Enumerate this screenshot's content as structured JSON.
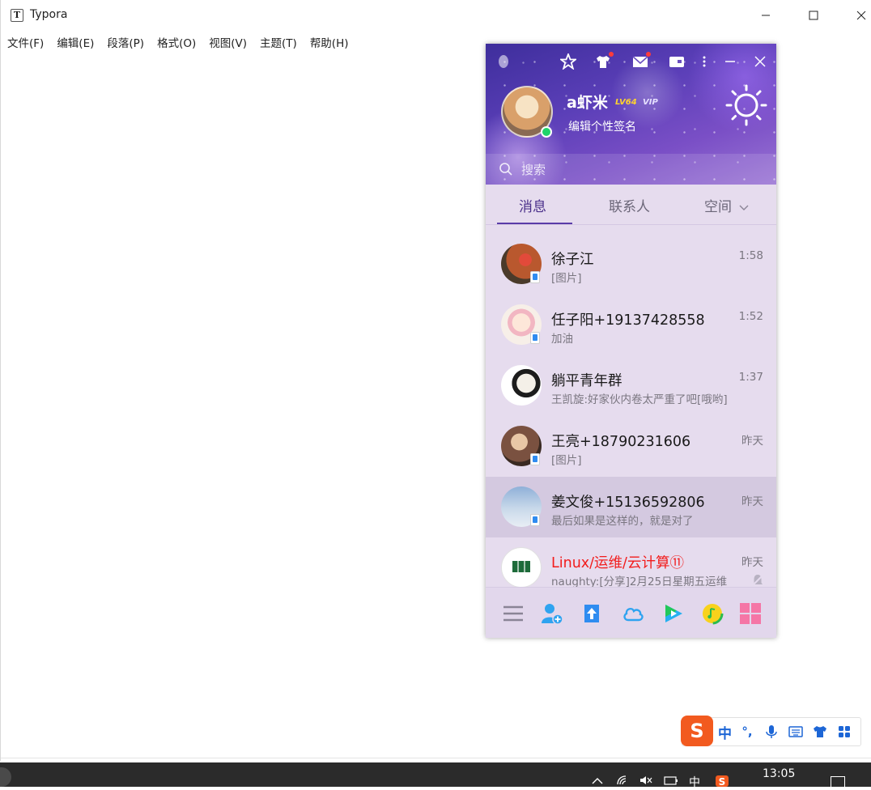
{
  "typora": {
    "title": "Typora",
    "menu": [
      "文件(F)",
      "编辑(E)",
      "段落(P)",
      "格式(O)",
      "视图(V)",
      "主题(T)",
      "帮助(H)"
    ]
  },
  "qq": {
    "profile": {
      "nickname": "a虾米",
      "level": "LV64",
      "vip": "VIP",
      "signature": "编辑个性签名",
      "online": true
    },
    "search_placeholder": "搜索",
    "tabs": [
      "消息",
      "联系人",
      "空间"
    ],
    "active_tab": "消息",
    "conversations": [
      {
        "name": "徐子江",
        "preview": "[图片]",
        "time": "1:58",
        "mobile": true,
        "avatar_color": "#b9582e"
      },
      {
        "name": "任子阳+19137428558",
        "preview": "加油",
        "time": "1:52",
        "mobile": true,
        "avatar_color": "#f2e4dc"
      },
      {
        "name": "躺平青年群",
        "preview": "王凯旋:好家伙内卷太严重了吧[哦哟]",
        "time": "1:37",
        "mobile": false,
        "avatar_color": "#ffffff"
      },
      {
        "name": "王亮+18790231606",
        "preview": "[图片]",
        "time": "昨天",
        "mobile": true,
        "avatar_color": "#7a5140"
      },
      {
        "name": "姜文俊+15136592806",
        "preview": "最后如果是这样的，就是对了",
        "time": "昨天",
        "mobile": true,
        "avatar_color": "#a9bfd8",
        "selected": true
      },
      {
        "name": "Linux/运维/云计算⑪",
        "preview": "naughty:[分享]2月25日星期五运维",
        "time": "昨天",
        "mobile": false,
        "avatar_color": "#ffffff",
        "highlight": true,
        "muted": true
      }
    ],
    "accent_color": "#5a3ca8"
  },
  "ime": {
    "mode": "中",
    "punct": "°,"
  },
  "taskbar": {
    "clock": "13:05",
    "tray_ime": "中"
  }
}
